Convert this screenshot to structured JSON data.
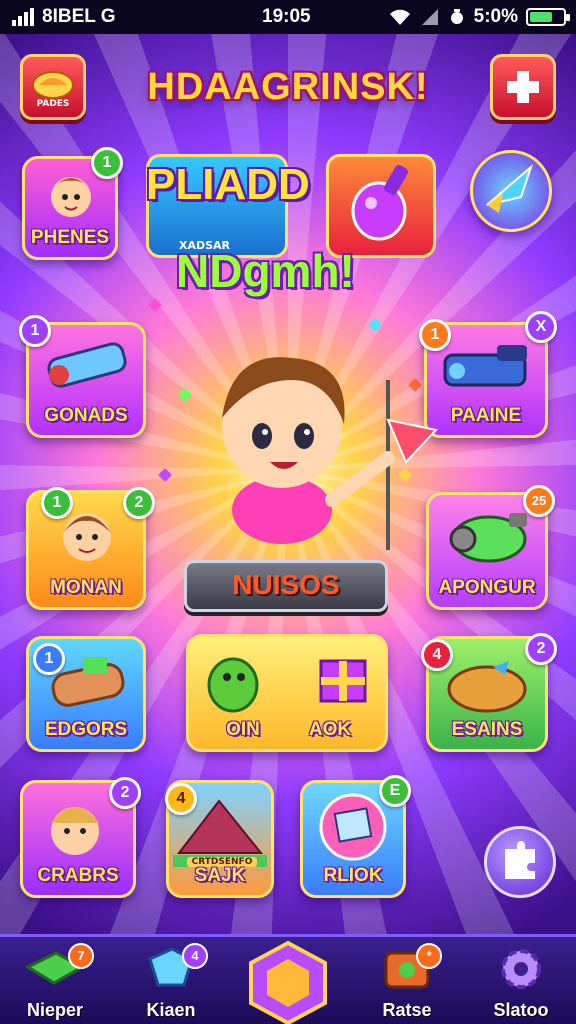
{
  "status_bar": {
    "carrier": "8IBEL G",
    "time": "19:05",
    "battery_text": "5:0%"
  },
  "header": {
    "title": "HDAAGRINSK!",
    "left_button_label": "PADES"
  },
  "promo": {
    "title": "PLIADD",
    "subtitle": "NDgmh!",
    "left_caption": "XADSAR"
  },
  "hero": {
    "cta_label": "NUISOS"
  },
  "tiles": [
    {
      "label": "PHENES",
      "badge": "1"
    },
    {
      "label": "GONADS",
      "badge": "1"
    },
    {
      "label": "PAAINE",
      "badge_left": "1",
      "badge_right": "X"
    },
    {
      "label": "MONAN",
      "badge_left": "1",
      "badge_right": "2"
    },
    {
      "label": "APONGUR",
      "badge": "25"
    },
    {
      "label": "EDGORS",
      "badge": "1"
    },
    {
      "label_left": "OIN",
      "label_right": "AOK"
    },
    {
      "label": "ESAINS",
      "badge_left": "4",
      "badge_right": "2"
    },
    {
      "label": "CRABRS",
      "badge": "2"
    },
    {
      "label": "SAJK",
      "badge": "4",
      "sign_text": "CRTDSENFO"
    },
    {
      "label": "RLIOK",
      "badge": "E"
    }
  ],
  "bottom_nav": [
    {
      "label": "Nieper",
      "badge": "7"
    },
    {
      "label": "Kiaen",
      "badge": "4"
    },
    {
      "label": ""
    },
    {
      "label": "Ratse",
      "badge": "*"
    },
    {
      "label": "Slatoo"
    }
  ],
  "colors": {
    "title": "#ffd83b",
    "tile_border": "#ffe36b",
    "navbar": "#2a158a",
    "badge_green": "#3bbf3b",
    "badge_orange": "#ff7a1a",
    "badge_red": "#e8213d",
    "badge_purple": "#a040ff"
  }
}
